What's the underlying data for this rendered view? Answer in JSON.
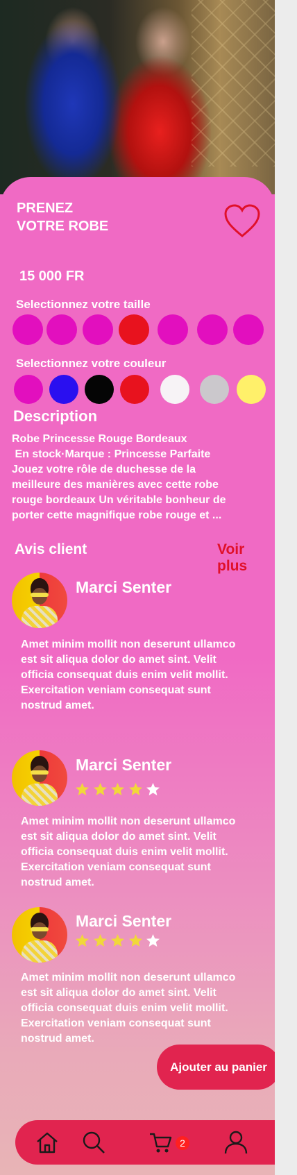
{
  "product": {
    "title_line1": "PRENEZ",
    "title_line2": "VOTRE ROBE",
    "price": "15 000 FR",
    "favorite_icon": "heart-icon"
  },
  "size": {
    "label": "Selectionnez votre taille",
    "options": [
      {
        "color": "#e20fbe"
      },
      {
        "color": "#e20fbe"
      },
      {
        "color": "#e20fbe"
      },
      {
        "color": "#e8121e",
        "selected": true
      },
      {
        "color": "#e20fbe"
      },
      {
        "color": "#e20fbe"
      },
      {
        "color": "#e20fbe"
      }
    ]
  },
  "color": {
    "label": "Selectionnez votre couleur",
    "options": [
      {
        "color": "#e20fbe"
      },
      {
        "color": "#2a0ff0"
      },
      {
        "color": "#050505"
      },
      {
        "color": "#e8121e"
      },
      {
        "color": "#f7f3f6"
      },
      {
        "color": "#cbc8cc"
      },
      {
        "color": "#fff06a"
      }
    ]
  },
  "description": {
    "heading": "Description",
    "lines": [
      "Robe Princesse Rouge Bordeaux",
      " En stock·Marque : Princesse Parfaite",
      "Jouez votre rôle de duchesse de la",
      "meilleure des manières avec cette robe",
      "rouge bordeaux Un véritable bonheur de",
      "porter cette magnifique robe rouge et ..."
    ]
  },
  "reviews": {
    "heading": "Avis client",
    "see_more": "Voir plus",
    "items": [
      {
        "name": "Marci Senter",
        "rating": null,
        "lines": [
          "Amet minim mollit non deserunt ullamco",
          "est sit aliqua dolor do amet sint. Velit",
          "officia consequat duis enim velit mollit.",
          "Exercitation veniam consequat sunt",
          "nostrud amet."
        ]
      },
      {
        "name": "Marci Senter",
        "rating": 4,
        "lines": [
          "Amet minim mollit non deserunt ullamco",
          "est sit aliqua dolor do amet sint. Velit",
          "officia consequat duis enim velit mollit.",
          "Exercitation veniam consequat sunt",
          "nostrud amet."
        ]
      },
      {
        "name": "Marci Senter",
        "rating": 4,
        "lines": [
          "Amet minim mollit non deserunt ullamco",
          "est sit aliqua dolor do amet sint. Velit",
          "officia consequat duis enim velit mollit.",
          "Exercitation veniam consequat sunt",
          "nostrud amet."
        ]
      }
    ]
  },
  "actions": {
    "add_to_cart": "Ajouter au panier"
  },
  "nav": {
    "items": [
      {
        "icon": "home-icon"
      },
      {
        "icon": "search-icon"
      },
      {
        "icon": "cart-icon",
        "badge": "2"
      },
      {
        "icon": "user-icon"
      }
    ]
  },
  "colors": {
    "background": "#f06ac4",
    "accent": "#e1244f",
    "link": "#e0102a",
    "star": "#f1d83a"
  }
}
